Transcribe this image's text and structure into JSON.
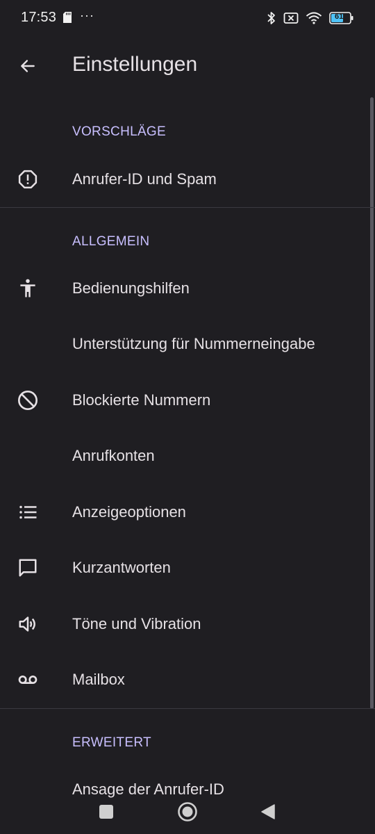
{
  "status_bar": {
    "time": "17:53",
    "dots": "···",
    "battery_level": "61",
    "icons": [
      "sd-card-icon",
      "bluetooth-icon",
      "no-sim-icon",
      "wifi-icon",
      "battery-icon"
    ]
  },
  "app_bar": {
    "title": "Einstellungen",
    "back_icon": "arrow-back-icon"
  },
  "sections": {
    "suggestions": {
      "header": "VORSCHLÄGE",
      "items": [
        {
          "label": "Anrufer-ID und Spam",
          "icon": "spam-alert-icon"
        }
      ]
    },
    "general": {
      "header": "ALLGEMEIN",
      "items": [
        {
          "label": "Bedienungshilfen",
          "icon": "accessibility-icon"
        },
        {
          "label": "Unterstützung für Nummerneingabe",
          "icon": ""
        },
        {
          "label": "Blockierte Nummern",
          "icon": "block-icon"
        },
        {
          "label": "Anrufkonten",
          "icon": ""
        },
        {
          "label": "Anzeigeoptionen",
          "icon": "list-icon"
        },
        {
          "label": "Kurzantworten",
          "icon": "message-icon"
        },
        {
          "label": "Töne und Vibration",
          "icon": "volume-icon"
        },
        {
          "label": "Mailbox",
          "icon": "voicemail-icon"
        }
      ]
    },
    "advanced": {
      "header": "ERWEITERT",
      "items": [
        {
          "label": "Ansage der Anrufer-ID",
          "icon": ""
        }
      ]
    }
  },
  "nav_bar": {
    "icons": [
      "recents-square-icon",
      "home-circle-icon",
      "back-triangle-icon"
    ]
  },
  "colors": {
    "background": "#1f1e22",
    "section_header": "#c8bfff",
    "text": "#e6e1e5",
    "divider": "#3a3940"
  }
}
